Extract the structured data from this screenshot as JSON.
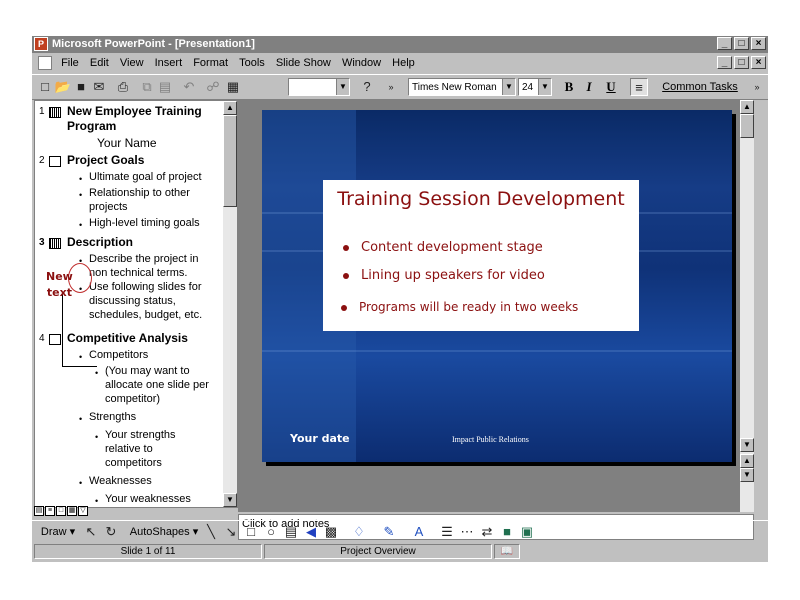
{
  "window": {
    "title": "Microsoft PowerPoint - [Presentation1]",
    "buttons": [
      "_",
      "□",
      "×"
    ]
  },
  "menubar": {
    "items": [
      "File",
      "Edit",
      "View",
      "Insert",
      "Format",
      "Tools",
      "Slide Show",
      "Window",
      "Help"
    ]
  },
  "toolbar": {
    "font": "Times New Roman",
    "size": "24",
    "bold": "B",
    "italic": "I",
    "underline": "U",
    "common_tasks": "Common Tasks"
  },
  "outline": [
    {
      "num": "1",
      "title": "New Employee Training",
      "title2": "Program",
      "sub": "Your Name"
    },
    {
      "num": "2",
      "title": "Project Goals",
      "bullets": [
        "Ultimate goal of project",
        "Relationship to other",
        "projects",
        "High-level timing goals"
      ]
    },
    {
      "num": "3",
      "title": "Description",
      "bullets": [
        "Describe the project in",
        "non technical terms.",
        "Use following slides for",
        "discussing status,",
        "schedules, budget, etc."
      ]
    },
    {
      "num": "4",
      "title": "Competitive Analysis",
      "bullets": [
        "Competitors",
        "(You may want to",
        "allocate one slide per",
        "competitor)",
        "Strengths",
        "Your strengths",
        "relative to",
        "competitors",
        "Weaknesses",
        "Your weaknesses"
      ]
    }
  ],
  "annotation": {
    "line1": "New",
    "line2": "text"
  },
  "slide": {
    "title": "Training Session Development",
    "bullets": [
      "Content development stage",
      "Lining up speakers for video",
      "Programs will be ready in two weeks"
    ],
    "date": "Your date",
    "footer": "Impact Public Relations"
  },
  "notes": {
    "placeholder": "Click to add notes"
  },
  "drawbar": {
    "draw": "Draw",
    "autoshapes": "AutoShapes"
  },
  "status": {
    "slide": "Slide 1 of 11",
    "design": "Project Overview"
  }
}
